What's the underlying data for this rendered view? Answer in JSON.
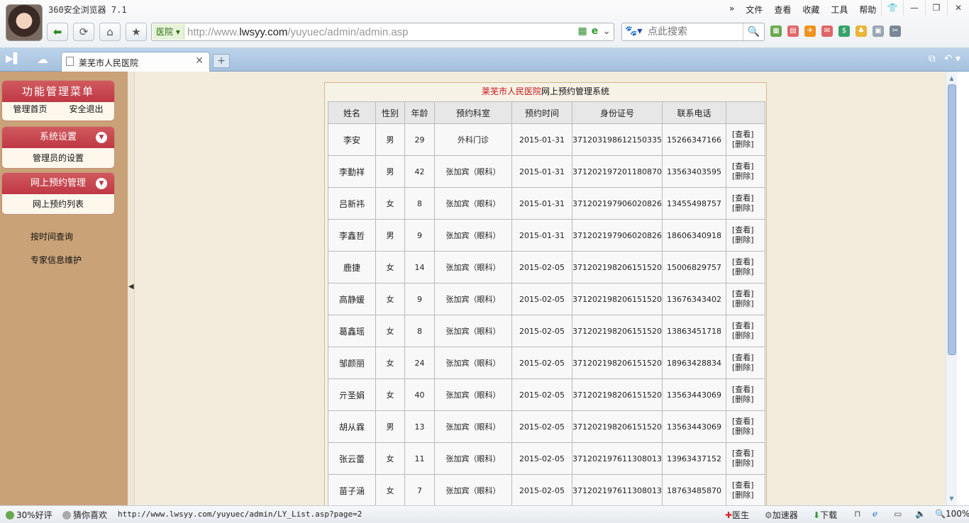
{
  "browser": {
    "title": "360安全浏览器 7.1",
    "menu": [
      "»",
      "文件",
      "查看",
      "收藏",
      "工具",
      "帮助"
    ],
    "address_tag": "医院",
    "address_prefix": "http://www.",
    "address_domain": "lwsyy.com",
    "address_path": "/yuyuec/admin/admin.asp",
    "search_placeholder": "点此搜索",
    "tab_title": "莱芜市人民医院"
  },
  "sidebar": {
    "main_menu_title": "功能管理菜单",
    "main_links": [
      "管理首页",
      "安全退出"
    ],
    "section1_title": "系统设置",
    "section1_item": "管理员的设置",
    "section2_title": "网上预约管理",
    "section2_item": "网上预约列表",
    "extra_links": [
      "按时间查询",
      "专家信息维护"
    ]
  },
  "main": {
    "title_red": "莱芜市人民医院",
    "title_rest": "网上预约管理系统",
    "headers": [
      "姓名",
      "性别",
      "年龄",
      "预约科室",
      "预约时间",
      "身份证号",
      "联系电话",
      ""
    ],
    "view_label": "[查看]",
    "delete_label": "[删除]",
    "rows": [
      [
        "李安",
        "男",
        "29",
        "外科门诊",
        "2015-01-31",
        "371203198612150335",
        "15266347166"
      ],
      [
        "李勤祥",
        "男",
        "42",
        "张加宾（眼科）",
        "2015-01-31",
        "371202197201180870",
        "13563403595"
      ],
      [
        "吕新祎",
        "女",
        "8",
        "张加宾（眼科）",
        "2015-01-31",
        "371202197906020826",
        "13455498757"
      ],
      [
        "李鑫哲",
        "男",
        "9",
        "张加宾（眼科）",
        "2015-01-31",
        "371202197906020826",
        "18606340918"
      ],
      [
        "鹿捷",
        "女",
        "14",
        "张加宾（眼科）",
        "2015-02-05",
        "371202198206151520",
        "15006829757"
      ],
      [
        "高静媛",
        "女",
        "9",
        "张加宾（眼科）",
        "2015-02-05",
        "371202198206151520",
        "13676343402"
      ],
      [
        "葛鑫瑶",
        "女",
        "8",
        "张加宾（眼科）",
        "2015-02-05",
        "371202198206151520",
        "13863451718"
      ],
      [
        "邹颜丽",
        "女",
        "24",
        "张加宾（眼科）",
        "2015-02-05",
        "371202198206151520",
        "18963428834"
      ],
      [
        "亓圣娟",
        "女",
        "40",
        "张加宾（眼科）",
        "2015-02-05",
        "371202198206151520",
        "13563443069"
      ],
      [
        "胡从霖",
        "男",
        "13",
        "张加宾（眼科）",
        "2015-02-05",
        "371202198206151520",
        "13563443069"
      ],
      [
        "张云蕾",
        "女",
        "11",
        "张加宾（眼科）",
        "2015-02-05",
        "371202197611308013",
        "13963437152"
      ],
      [
        "苗子涵",
        "女",
        "7",
        "张加宾（眼科）",
        "2015-02-05",
        "371202197611308013",
        "18763485870"
      ]
    ]
  },
  "status": {
    "rating": "30%好评",
    "guess": "猜你喜欢",
    "url": "http://www.lwsyy.com/yuyuec/admin/LY_List.asp?page=2",
    "doctor": "医生",
    "accelerator": "加速器",
    "download": "下载",
    "zoom": "100%"
  },
  "colors": {
    "left_panel": "#c9a277",
    "menu_header": "#bf3845",
    "page_bg": "#f3ecdc",
    "title_red": "#c5161b"
  }
}
